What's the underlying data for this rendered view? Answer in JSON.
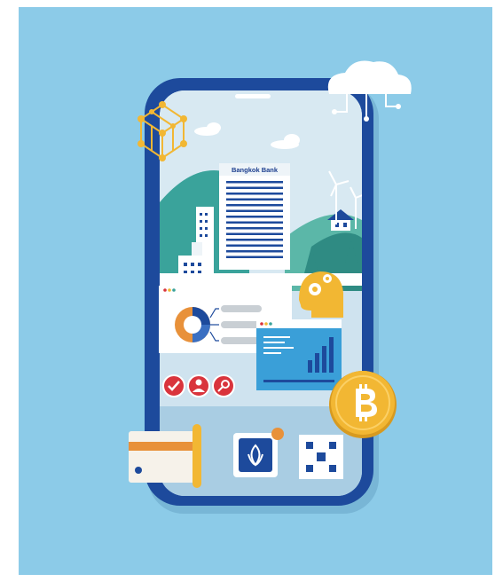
{
  "illustration": {
    "building_sign": "Bangkok Bank",
    "colors": {
      "background": "#8ccbe8",
      "phone_frame": "#1d4a9c",
      "screen": "#cfe3ef",
      "accent_red": "#d9343c",
      "coin_gold": "#f2b733",
      "hill_teal": "#3aa39b",
      "card_orange": "#e8913a"
    },
    "icons": [
      "cube-network-icon",
      "cloud-icon",
      "bitcoin-coin-icon",
      "credit-card-icon",
      "bank-logo-app-icon",
      "qr-code-icon",
      "check-icon",
      "user-icon",
      "search-icon",
      "gear-icon",
      "donut-chart-icon",
      "bar-chart-icon",
      "wind-turbine-icon"
    ]
  }
}
